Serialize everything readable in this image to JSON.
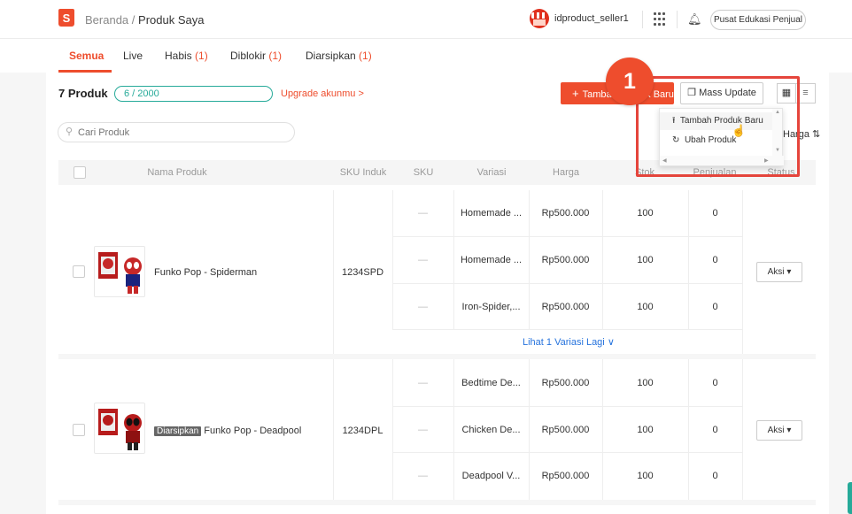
{
  "breadcrumb": {
    "home": "Beranda",
    "separator": "/",
    "current": "Produk Saya"
  },
  "logo": {
    "letter": "S"
  },
  "header": {
    "seller_name": "idproduct_seller1",
    "pusat_label": "Pusat Edukasi Penjual"
  },
  "tabs": [
    {
      "label": "Semua",
      "count": ""
    },
    {
      "label": "Live",
      "count": ""
    },
    {
      "label": "Habis",
      "count": "(1)"
    },
    {
      "label": "Diblokir",
      "count": "(1)"
    },
    {
      "label": "Diarsipkan",
      "count": "(1)"
    }
  ],
  "summary": {
    "count_label": "7 Produk",
    "quota": "6 / 2000",
    "upgrade": "Upgrade akunmu >"
  },
  "toolbar": {
    "add_label": "Tambah Produk Baru",
    "add_plus": "+",
    "mass_label": "Mass Update"
  },
  "search": {
    "placeholder": "Cari Produk"
  },
  "sort_label": "Harga",
  "table": {
    "headers": [
      "Nama Produk",
      "SKU Induk",
      "SKU",
      "Variasi",
      "Harga",
      "Stok",
      "Penjualan",
      "Status"
    ],
    "products": [
      {
        "name": "Funko Pop - Spiderman",
        "badge": "",
        "sku_induk": "1234SPD",
        "variations": [
          {
            "sku": "—",
            "variasi": "Homemade ...",
            "harga": "Rp500.000",
            "stok": "100",
            "penjualan": "0"
          },
          {
            "sku": "—",
            "variasi": "Homemade ...",
            "harga": "Rp500.000",
            "stok": "100",
            "penjualan": "0"
          },
          {
            "sku": "—",
            "variasi": "Iron-Spider,...",
            "harga": "Rp500.000",
            "stok": "100",
            "penjualan": "0"
          }
        ],
        "more_label": "Lihat 1 Variasi Lagi",
        "action": "Aksi"
      },
      {
        "name": "Funko Pop - Deadpool",
        "badge": "Diarsipkan",
        "sku_induk": "1234DPL",
        "variations": [
          {
            "sku": "—",
            "variasi": "Bedtime De...",
            "harga": "Rp500.000",
            "stok": "100",
            "penjualan": "0"
          },
          {
            "sku": "—",
            "variasi": "Chicken De...",
            "harga": "Rp500.000",
            "stok": "100",
            "penjualan": "0"
          },
          {
            "sku": "—",
            "variasi": "Deadpool V...",
            "harga": "Rp500.000",
            "stok": "100",
            "penjualan": "0"
          }
        ],
        "action": "Aksi"
      }
    ]
  },
  "dropdown": {
    "items": [
      "Tambah Produk Baru",
      "Ubah Produk"
    ]
  },
  "annotation": {
    "step": "1"
  },
  "colors": {
    "accent": "#ee4d2d",
    "teal": "#26aa99",
    "link": "#2673dd",
    "highlight": "#e5453c"
  }
}
